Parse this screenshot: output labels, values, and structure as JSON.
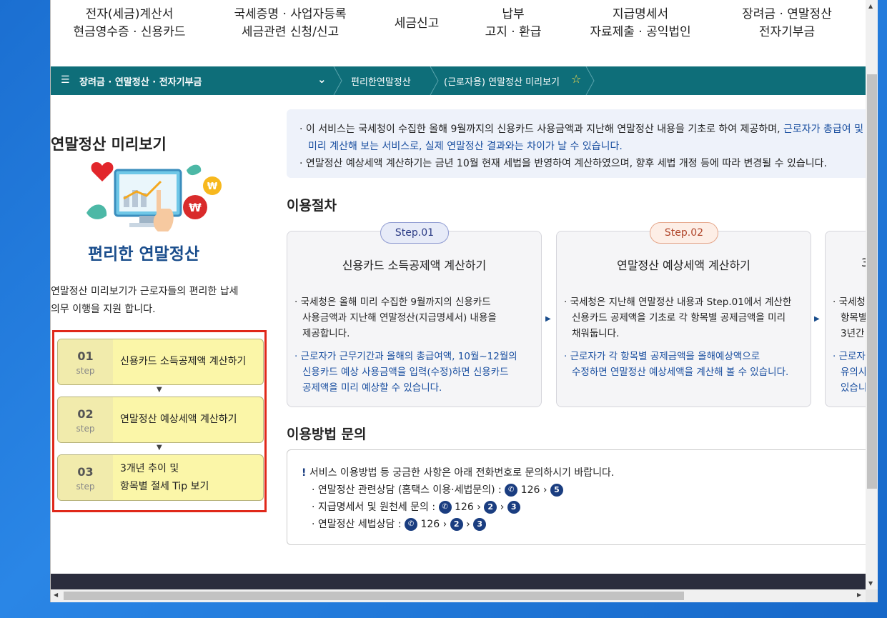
{
  "top_nav": [
    {
      "line1": "전자(세금)계산서",
      "line2": "현금영수증 · 신용카드"
    },
    {
      "line1": "국세증명 · 사업자등록",
      "line2": "세금관련 신청/신고"
    },
    {
      "line1": "세금신고",
      "line2": ""
    },
    {
      "line1": "납부",
      "line2": "고지 · 환급"
    },
    {
      "line1": "지급명세서",
      "line2": "자료제출 · 공익법인"
    },
    {
      "line1": "장려금 · 연말정산",
      "line2": "전자기부금"
    }
  ],
  "breadcrumb": {
    "menu_icon": "hamburger-icon",
    "section": "장려금 · 연말정산 · 전자기부금",
    "crumb1": "편리한연말정산",
    "crumb2": "(근로자용) 연말정산 미리보기",
    "bookmark_icon": "star-outline-icon"
  },
  "left": {
    "title": "연말정산 미리보기",
    "illustration_caption": "편리한 연말정산",
    "description_line1": "연말정산 미리보기가 근로자들의  편리한 납세",
    "description_line2": "의무 이행을 지원 합니다.",
    "steps": [
      {
        "num": "01",
        "unit": "step",
        "label": "신용카드 소득공제액 계산하기",
        "label2": ""
      },
      {
        "num": "02",
        "unit": "step",
        "label": "연말정산 예상세액 계산하기",
        "label2": ""
      },
      {
        "num": "03",
        "unit": "step",
        "label": "3개년 추이 및",
        "label2": "항목별 절세 Tip 보기"
      }
    ]
  },
  "notice": {
    "l1_a": "이 서비스는 국세청이 수집한 올해 9월까지의 신용카드 사용금액과 지난해 연말정산 내용을 기초로 하여 제공하며, ",
    "l1_b": "근로자가 총급여 및",
    "l2": "미리 계산해 보는 서비스로, 실제 연말정산 결과와는 차이가 날 수 있습니다.",
    "l3": "연말정산 예상세액 계산하기는 금년 10월 현재 세법을 반영하여 계산하였으며, 향후 세법 개정 등에 따라 변경될 수 있습니다."
  },
  "procedure": {
    "heading": "이용절차",
    "cards": [
      {
        "pill": "Step.01",
        "title": "신용카드 소득공제액 계산하기",
        "b1": "국세청은 올해 미리 수집한 9월까지의 신용카드",
        "b2": "사용금액과 지난해 연말정산(지급명세서) 내용을",
        "b3": "제공합니다.",
        "c1": "근로자가 근무기간과 올해의 총급여액, 10월~12월의",
        "c2": "신용카드 예상 사용금액을 입력(수정)하면 신용카드",
        "c3": "공제액을 미리 예상할 수 있습니다."
      },
      {
        "pill": "Step.02",
        "title": "연말정산 예상세액 계산하기",
        "b1": "국세청은 지난해 연말정산 내용과 Step.01에서 계산한",
        "b2": "신용카드 공제액을 기초로 각 항목별 공제금액을 미리",
        "b3": "채워둡니다.",
        "c1": "근로자가 각 항목별 공제금액을 올해예상액으로",
        "c2": "수정하면 연말정산 예상세액을 계산해 볼 수 있습니다.",
        "c3": ""
      },
      {
        "pill": "",
        "title": "3",
        "b1": "국세청",
        "b2": "항목별",
        "b3": "3년간",
        "c1": "근로자",
        "c2": "유의사",
        "c3": "있습니"
      }
    ]
  },
  "inquiry": {
    "heading": "이용방법 문의",
    "intro": "서비스 이용방법 등 궁금한 사항은 아래 전화번호로 문의하시기 바랍니다.",
    "lines": [
      {
        "label": "연말정산 관련상담 (홈택스 이용·세법문의) : ",
        "phone": "126",
        "keys": [
          "5"
        ]
      },
      {
        "label": "지급명세서 및 원천세 문의 : ",
        "phone": "126",
        "keys": [
          "2",
          "3"
        ]
      },
      {
        "label": "연말정산 세법상담 : ",
        "phone": "126",
        "keys": [
          "2",
          "3"
        ]
      }
    ]
  },
  "colors": {
    "breadcrumb_bg": "#0e6e79",
    "step_bg": "#fbf6a8",
    "highlight_border": "#e0281a",
    "link_blue": "#1a4fa0"
  }
}
